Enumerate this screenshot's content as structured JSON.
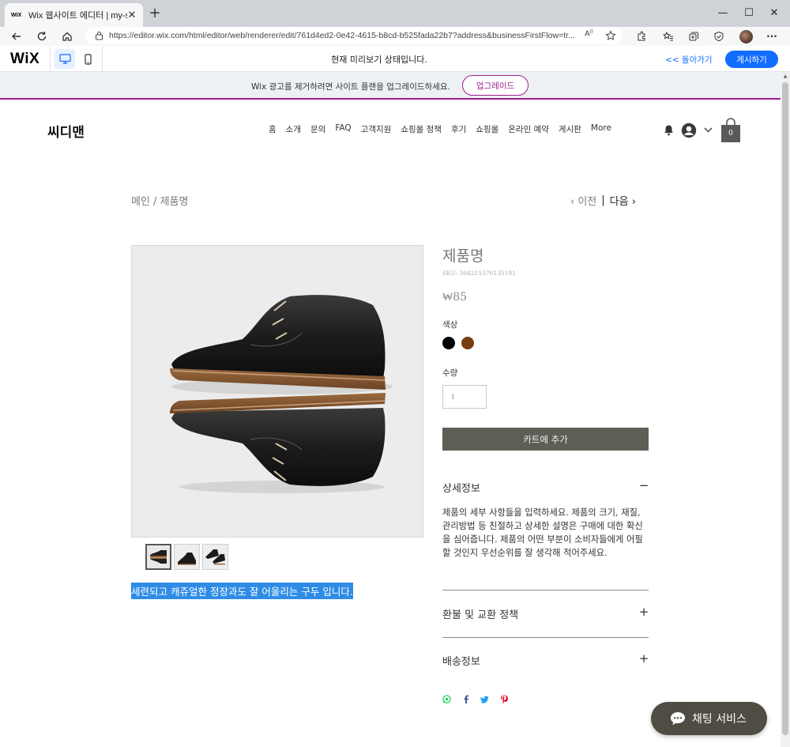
{
  "browser": {
    "tab_favicon": "WiX",
    "tab_title": "Wix 웹사이트 에디터 | my-site",
    "tab_close": "✕",
    "new_tab": "+",
    "url": "https://editor.wix.com/html/editor/web/renderer/edit/761d4ed2-0e42-4615-b8cd-b525fada22b7?address&businessFirstFlow=tr...",
    "window_controls": {
      "minimize": "—",
      "maximize": "☐",
      "close": "✕"
    },
    "menu": "···"
  },
  "wix_bar": {
    "logo": "WiX",
    "preview_label": "현재 미리보기 상태입니다.",
    "back_label": "<< 돌아가기",
    "publish_label": "게시하기"
  },
  "upgrade_banner": {
    "text": "Wix 광고를 제거하려면 사이트 플랜을 업그레이드하세요.",
    "button": "업그레이드"
  },
  "site": {
    "logo": "씨디맨",
    "nav": [
      "홈",
      "소개",
      "문의",
      "FAQ",
      "고객지원",
      "쇼핑몰 정책",
      "후기",
      "쇼핑몰",
      "온라인 예약",
      "게시판",
      "More"
    ],
    "cart_count": "0"
  },
  "breadcrumb": {
    "path": "메인 / 제품명",
    "prev": "‹ 이전",
    "separator": "|",
    "next": "다음 ›"
  },
  "product": {
    "title": "제품명",
    "sku": "SKU: 364215376135191",
    "price": "₩85",
    "color_label": "색상",
    "colors": [
      "#000000",
      "#7a3d10"
    ],
    "quantity_label": "수량",
    "quantity": "1",
    "add_to_cart": "카트에 추가",
    "description_selected": "세련되고 캐쥬얼한 정장과도 잘 어울리는 구두 입니다.",
    "sections": [
      {
        "title": "상세정보",
        "sign": "−",
        "body": "제품의 세부 사항들을 입력하세요. 제품의 크기, 재질, 관리방법 등 친절하고 상세한 설명은 구매에 대한 확신을 심어줍니다. 제품의 어떤 부분이 소비자들에게 어필할 것인지 우선순위를 잘 생각해 적어주세요."
      },
      {
        "title": "환불 및 교환 정책",
        "sign": "+"
      },
      {
        "title": "배송정보",
        "sign": "+"
      }
    ],
    "share_icons": [
      "whatsapp-icon",
      "facebook-icon",
      "twitter-icon",
      "pinterest-icon"
    ]
  },
  "chat": {
    "label": "채팅 서비스"
  }
}
